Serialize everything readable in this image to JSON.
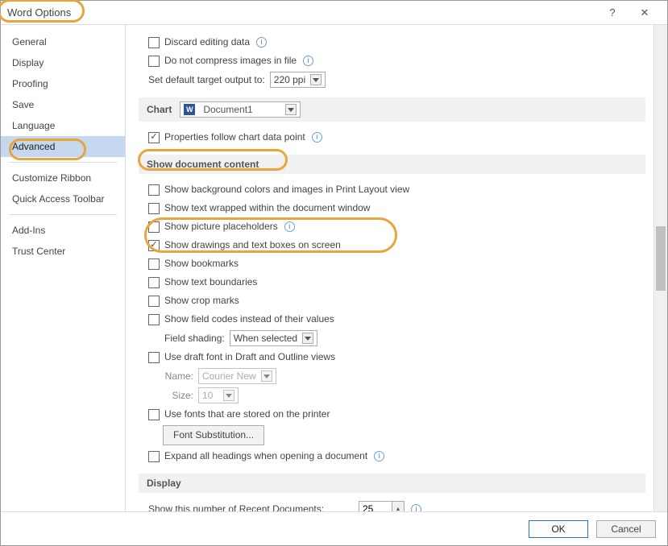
{
  "window": {
    "title": "Word Options"
  },
  "sidebar": {
    "items": [
      {
        "label": "General"
      },
      {
        "label": "Display"
      },
      {
        "label": "Proofing"
      },
      {
        "label": "Save"
      },
      {
        "label": "Language"
      },
      {
        "label": "Advanced",
        "selected": true
      },
      {
        "label": "Customize Ribbon"
      },
      {
        "label": "Quick Access Toolbar"
      },
      {
        "label": "Add-Ins"
      },
      {
        "label": "Trust Center"
      }
    ]
  },
  "top": {
    "discard": "Discard editing data",
    "nocompress": "Do not compress images in file",
    "defaultTargetLabel": "Set default target output to:",
    "ppi": "220 ppi"
  },
  "chart": {
    "section": "Chart",
    "document": "Document1",
    "propFollow": "Properties follow chart data point"
  },
  "showContent": {
    "section": "Show document content",
    "bg": "Show background colors and images in Print Layout view",
    "wrap": "Show text wrapped within the document window",
    "picplace": "Show picture placeholders",
    "drawings": "Show drawings and text boxes on screen",
    "bookmarks": "Show bookmarks",
    "textbound": "Show text boundaries",
    "cropmarks": "Show crop marks",
    "fieldcodes": "Show field codes instead of their values",
    "fieldShadingLabel": "Field shading:",
    "fieldShadingValue": "When selected",
    "draftFont": "Use draft font in Draft and Outline views",
    "nameLabel": "Name:",
    "nameValue": "Courier New",
    "sizeLabel": "Size:",
    "sizeValue": "10",
    "printerFonts": "Use fonts that are stored on the printer",
    "fontSubBtn": "Font Substitution...",
    "expandHeadings": "Expand all headings when opening a document"
  },
  "display": {
    "section": "Display",
    "recentLabel": "Show this number of Recent Documents:",
    "recentValue": "25"
  },
  "footer": {
    "ok": "OK",
    "cancel": "Cancel"
  }
}
